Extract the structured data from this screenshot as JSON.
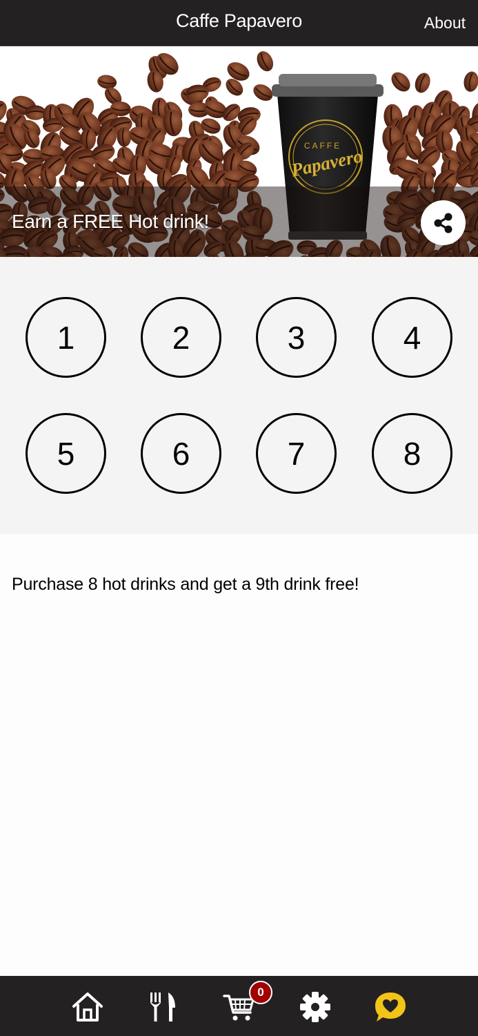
{
  "header": {
    "title": "Caffe Papavero",
    "about_label": "About"
  },
  "hero": {
    "headline": "Earn a FREE Hot drink!",
    "cup_brand_small": "CAFFE",
    "cup_brand_script": "Papavero",
    "share_icon": "share-icon"
  },
  "stamps": [
    "1",
    "2",
    "3",
    "4",
    "5",
    "6",
    "7",
    "8"
  ],
  "description": "Purchase 8 hot drinks and get a 9th drink free!",
  "bottom_nav": {
    "items": [
      "home-icon",
      "cutlery-icon",
      "cart-icon",
      "gear-icon",
      "loyalty-heart-icon"
    ],
    "cart_count": "0",
    "active_color": "#f2c418"
  },
  "colors": {
    "bar_background": "#242122",
    "badge": "#a00000",
    "accent_gold": "#c9a227"
  }
}
